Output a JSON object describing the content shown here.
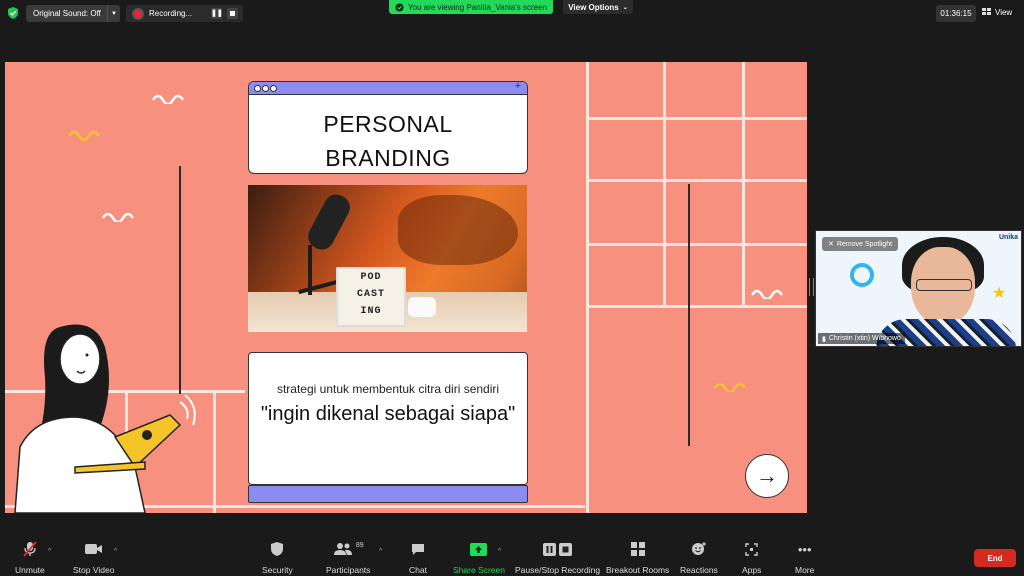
{
  "topbar": {
    "original_sound": "Original Sound: Off",
    "recording": "Recording...",
    "viewing_banner": "You are viewing Panitia_Vania's screen",
    "view_options": "View Options",
    "timer": "01:36:15",
    "view_label": "View"
  },
  "slide": {
    "title_line1": "PERSONAL",
    "title_line2": "BRANDING",
    "lightbox_lines": [
      "POD",
      "CAST",
      "ING"
    ],
    "subtitle": "strategi untuk membentuk citra diri sendiri",
    "quote": "\"ingin dikenal sebagai siapa\""
  },
  "participant": {
    "spotlight_label": "Remove Spotlight",
    "name": "Christin (xtin) Wibhowo",
    "logo": "Unika"
  },
  "toolbar": {
    "unmute": "Unmute",
    "stop_video": "Stop Video",
    "security": "Security",
    "participants": "Participants",
    "participants_count": "89",
    "chat": "Chat",
    "share_screen": "Share Screen",
    "pause_stop_recording": "Pause/Stop Recording",
    "breakout_rooms": "Breakout Rooms",
    "reactions": "Reactions",
    "apps": "Apps",
    "more": "More",
    "end": "End"
  },
  "colors": {
    "slide_bg": "#f7907f",
    "accent_purple": "#8c8cf0",
    "share_green": "#23d959",
    "end_red": "#d42a1f"
  }
}
